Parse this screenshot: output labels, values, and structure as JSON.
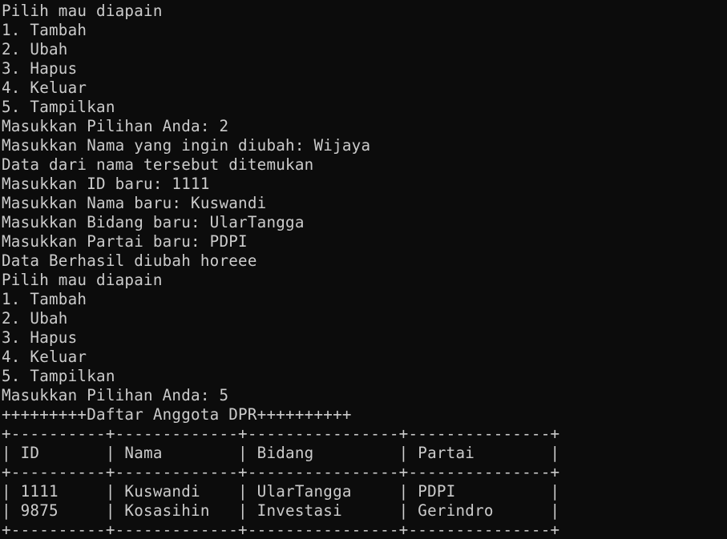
{
  "lines": [
    "Pilih mau diapain",
    "1. Tambah",
    "2. Ubah",
    "3. Hapus",
    "4. Keluar",
    "5. Tampilkan",
    "Masukkan Pilihan Anda: 2",
    "Masukkan Nama yang ingin diubah: Wijaya",
    "Data dari nama tersebut ditemukan",
    "Masukkan ID baru: 1111",
    "Masukkan Nama baru: Kuswandi",
    "Masukkan Bidang baru: UlarTangga",
    "Masukkan Partai baru: PDPI",
    "Data Berhasil diubah horeee",
    "Pilih mau diapain",
    "1. Tambah",
    "2. Ubah",
    "3. Hapus",
    "4. Keluar",
    "5. Tampilkan",
    "Masukkan Pilihan Anda: 5",
    "+++++++++Daftar Anggota DPR++++++++++",
    "+----------+-------------+----------------+---------------+",
    "| ID       | Nama        | Bidang         | Partai        |",
    "+----------+-------------+----------------+---------------+",
    "| 1111     | Kuswandi    | UlarTangga     | PDPI          |",
    "| 9875     | Kosasihin   | Investasi      | Gerindro      |",
    "+----------+-------------+----------------+---------------+"
  ],
  "colors": {
    "background": "#0c0c0c",
    "foreground": "#cccccc"
  }
}
